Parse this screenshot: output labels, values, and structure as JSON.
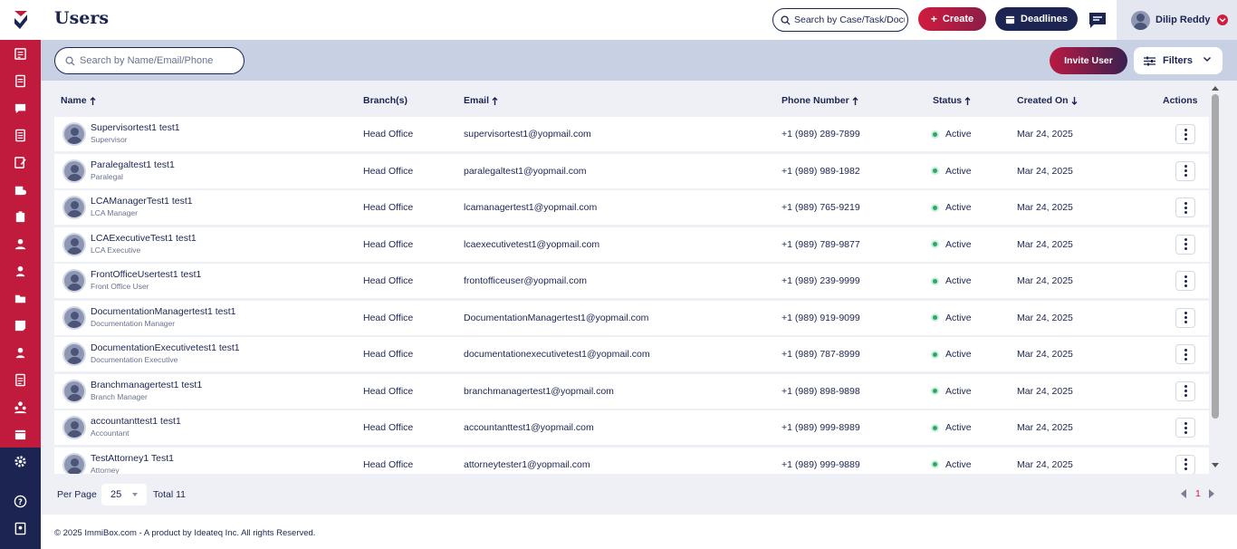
{
  "header": {
    "title": "Users",
    "search_placeholder": "Search by Case/Task/Document",
    "create_label": "Create",
    "deadlines_label": "Deadlines",
    "user_name": "Dilip Reddy"
  },
  "toolbar": {
    "search_placeholder": "Search by Name/Email/Phone",
    "invite_label": "Invite User",
    "filters_label": "Filters"
  },
  "table": {
    "columns": {
      "name": "Name",
      "branch": "Branch(s)",
      "email": "Email",
      "phone": "Phone Number",
      "status": "Status",
      "created": "Created On",
      "actions": "Actions"
    },
    "rows": [
      {
        "name": "Supervisortest1 test1",
        "role": "Supervisor",
        "branch": "Head Office",
        "email": "supervisortest1@yopmail.com",
        "phone": "+1 (989) 289-7899",
        "status": "Active",
        "created": "Mar 24, 2025"
      },
      {
        "name": "Paralegaltest1 test1",
        "role": "Paralegal",
        "branch": "Head Office",
        "email": "paralegaltest1@yopmail.com",
        "phone": "+1 (989) 989-1982",
        "status": "Active",
        "created": "Mar 24, 2025"
      },
      {
        "name": "LCAManagerTest1 test1",
        "role": "LCA Manager",
        "branch": "Head Office",
        "email": "lcamanagertest1@yopmail.com",
        "phone": "+1 (989) 765-9219",
        "status": "Active",
        "created": "Mar 24, 2025"
      },
      {
        "name": "LCAExecutiveTest1 test1",
        "role": "LCA Executive",
        "branch": "Head Office",
        "email": "lcaexecutivetest1@yopmail.com",
        "phone": "+1 (989) 789-9877",
        "status": "Active",
        "created": "Mar 24, 2025"
      },
      {
        "name": "FrontOfficeUsertest1 test1",
        "role": "Front Office User",
        "branch": "Head Office",
        "email": "frontofficeuser@yopmail.com",
        "phone": "+1 (989) 239-9999",
        "status": "Active",
        "created": "Mar 24, 2025"
      },
      {
        "name": "DocumentationManagertest1 test1",
        "role": "Documentation Manager",
        "branch": "Head Office",
        "email": "DocumentationManagertest1@yopmail.com",
        "phone": "+1 (989) 919-9099",
        "status": "Active",
        "created": "Mar 24, 2025"
      },
      {
        "name": "DocumentationExecutivetest1 test1",
        "role": "Documentation Executive",
        "branch": "Head Office",
        "email": "documentationexecutivetest1@yopmail.com",
        "phone": "+1 (989) 787-8999",
        "status": "Active",
        "created": "Mar 24, 2025"
      },
      {
        "name": "Branchmanagertest1 test1",
        "role": "Branch Manager",
        "branch": "Head Office",
        "email": "branchmanagertest1@yopmail.com",
        "phone": "+1 (989) 898-9898",
        "status": "Active",
        "created": "Mar 24, 2025"
      },
      {
        "name": "accountanttest1 test1",
        "role": "Accountant",
        "branch": "Head Office",
        "email": "accountanttest1@yopmail.com",
        "phone": "+1 (989) 999-8989",
        "status": "Active",
        "created": "Mar 24, 2025"
      },
      {
        "name": "TestAttorney1 Test1",
        "role": "Attorney",
        "branch": "Head Office",
        "email": "attorneytester1@yopmail.com",
        "phone": "+1 (989) 999-9889",
        "status": "Active",
        "created": "Mar 24, 2025"
      }
    ]
  },
  "pagination": {
    "per_page_label": "Per Page",
    "per_page_value": "25",
    "total_label": "Total 11",
    "current_page": "1"
  },
  "footer": {
    "text": "© 2025 ImmiBox.com - A product by Ideateq Inc. All rights Reserved."
  },
  "colors": {
    "brand_red": "#c01a3c",
    "brand_navy": "#1c2552",
    "status_active": "#2ba86a"
  },
  "sidebar_icons": [
    "cases-icon",
    "tasks-icon",
    "messages-icon",
    "documents-icon",
    "forms-icon",
    "companies-icon",
    "clipboard-icon",
    "client-icon",
    "contacts-icon",
    "folder-icon",
    "notes-icon",
    "users-icon",
    "reports-icon",
    "team-icon",
    "calendar-icon",
    "settings-icon",
    "help-icon",
    "guide-icon"
  ]
}
